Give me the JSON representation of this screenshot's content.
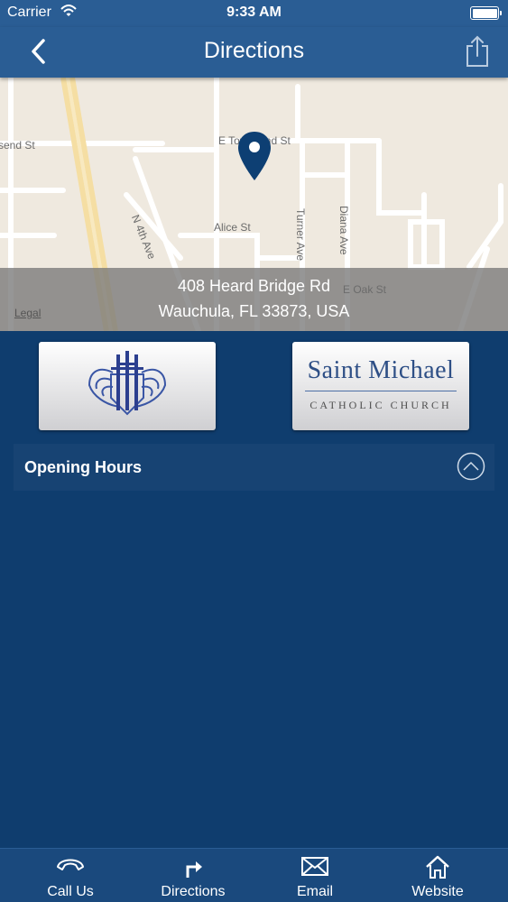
{
  "status_bar": {
    "carrier": "Carrier",
    "time": "9:33 AM"
  },
  "nav": {
    "title": "Directions",
    "back_icon": "chevron-left-icon",
    "share_icon": "share-icon"
  },
  "map": {
    "streets": [
      "send St",
      "E Townsend St",
      "N 4th Ave",
      "Alice St",
      "Turner Ave",
      "Diana Ave",
      "E Oak St"
    ],
    "legal": "Legal",
    "address": {
      "line1": "408 Heard Bridge Rd",
      "line2": "Wauchula, FL 33873, USA"
    },
    "pin_color": "#0d3f73"
  },
  "logos": {
    "right_line1": "Saint Michael",
    "right_line2": "CATHOLIC CHURCH"
  },
  "opening_hours": {
    "label": "Opening Hours",
    "toggle_icon": "chevron-up-circle-icon"
  },
  "tabs": [
    {
      "label": "Call Us",
      "icon": "phone-icon"
    },
    {
      "label": "Directions",
      "icon": "turn-right-arrow-icon"
    },
    {
      "label": "Email",
      "icon": "envelope-icon"
    },
    {
      "label": "Website",
      "icon": "home-icon"
    }
  ],
  "colors": {
    "bar": "#2a5d94",
    "background": "#0f3d6e",
    "tab_bar": "#1a497d"
  }
}
